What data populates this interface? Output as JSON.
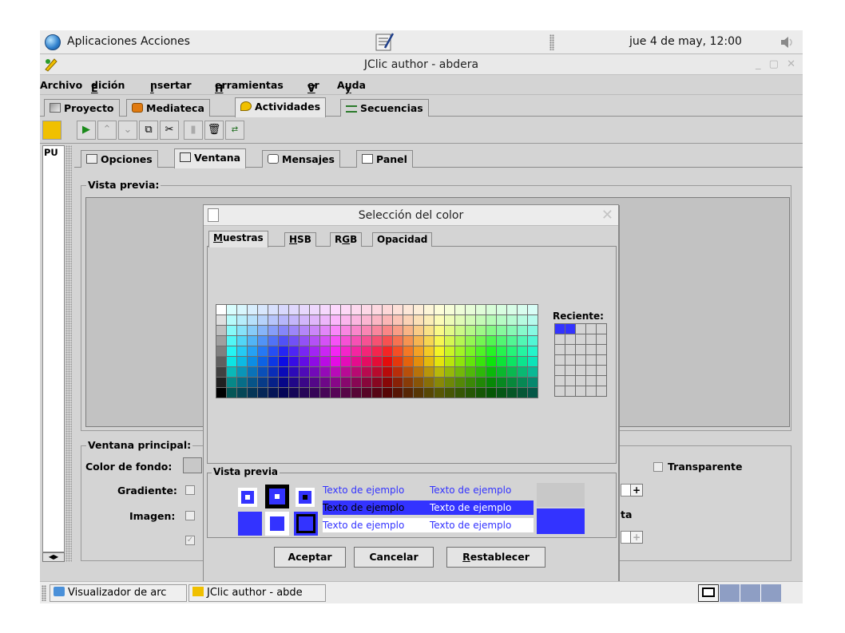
{
  "top_panel": {
    "applications": "Aplicaciones",
    "actions": "Acciones",
    "clock": "jue  4 de may, 12:00"
  },
  "window": {
    "title": "JClic author - abdera"
  },
  "menu": [
    "Archivo",
    "Edición",
    "Insertar",
    "Herramientas",
    "Ver",
    "Ayuda"
  ],
  "main_tabs": [
    "Proyecto",
    "Mediateca",
    "Actividades",
    "Secuencias"
  ],
  "left_list": {
    "item": "PU"
  },
  "sub_tabs": [
    "Opciones",
    "Ventana",
    "Mensajes",
    "Panel"
  ],
  "panel": {
    "preview_group": "Vista previa:",
    "main_window_group": "Ventana principal:",
    "bg_color_label": "Color de fondo:",
    "gradient_label": "Gradiente:",
    "image_label": "Imagen:",
    "transparent_label": "Transparente",
    "partial_label": "ta"
  },
  "dialog": {
    "title": "Selección del color",
    "tabs": [
      "Muestras",
      "HSB",
      "RGB",
      "Opacidad"
    ],
    "recent_label": "Reciente:",
    "preview_label": "Vista previa",
    "sample_text": "Texto de ejemplo",
    "buttons": {
      "accept": "Aceptar",
      "cancel": "Cancelar",
      "reset": "Restablecer"
    },
    "preview_color": "#3333ff",
    "recent_colors": [
      "#3333ff",
      "#3333ff"
    ]
  },
  "taskbar": {
    "task1": "Visualizador de arc",
    "task2": "JClic author - abde"
  }
}
